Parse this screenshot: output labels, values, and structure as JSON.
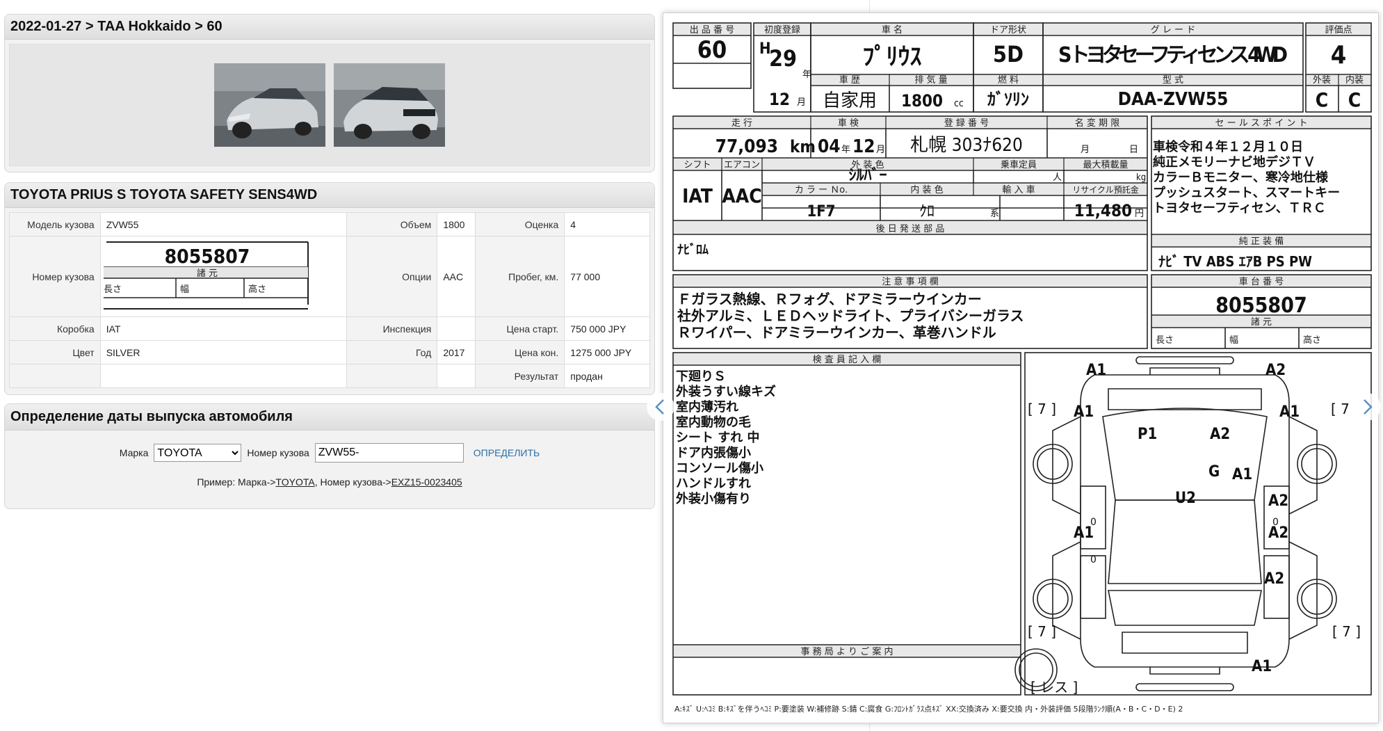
{
  "breadcrumb": "2022-01-27 > TAA Hokkaido > 60",
  "car_title": "TOYOTA PRIUS S TOYOTA SAFETY SENS4WD",
  "photos": [
    "front-left-view",
    "rear-right-view"
  ],
  "specs": {
    "body_model_label": "Модель кузова",
    "body_model": "ZVW55",
    "volume_label": "Объем",
    "volume": "1800",
    "grade_label": "Оценка",
    "grade": "4",
    "body_number_label": "Номер кузова",
    "options_label": "Опции",
    "options": "AAC",
    "mileage_label": "Пробег, км.",
    "mileage": "77 000",
    "gearbox_label": "Коробка",
    "gearbox": "IAT",
    "inspection_label": "Инспекция",
    "inspection": "",
    "start_price_label": "Цена старт.",
    "start_price": "750 000 JPY",
    "color_label": "Цвет",
    "color": "SILVER",
    "year_label": "Год",
    "year": "2017",
    "end_price_label": "Цена кон.",
    "end_price": "1275 000 JPY",
    "result_label": "Результат",
    "result": "продан"
  },
  "mini_sheet": {
    "number": "8055807",
    "specs": "諸 元",
    "length": "長さ",
    "width": "幅",
    "height": "高さ"
  },
  "date_tool": {
    "title": "Определение даты выпуска автомобиля",
    "make_label": "Марка",
    "make_value": "TOYOTA",
    "body_label": "Номер кузова",
    "body_value": "ZVW55-",
    "button": "ОПРЕДЕЛИТЬ",
    "example_prefix": "Пример: Марка->",
    "example_make": "TOYOTA",
    "example_mid": ", Номер кузова->",
    "example_body": "EXZ15-0023405"
  },
  "sheet": {
    "h_lot": "出 品 番 号",
    "lot": "60",
    "h_first_reg": "初度登録",
    "era": "H",
    "year_num": "29",
    "year_unit": "年",
    "month_num": "12",
    "month_unit": "月",
    "h_name": "車 名",
    "name": "ﾌﾟﾘｳｽ",
    "h_door": "ドア形状",
    "door": "5D",
    "h_grade": "グ レ ー ド",
    "grade": "S トヨタセーフティセンス 4WD",
    "h_score": "評価点",
    "score": "4",
    "h_history": "車 歴",
    "history": "自家用",
    "h_disp": "排 気 量",
    "disp": "1800",
    "disp_unit": "cc",
    "h_fuel": "燃 料",
    "fuel": "ｶﾞｿﾘﾝ",
    "h_model": "型 式",
    "model": "DAA-ZVW55",
    "h_ext": "外装",
    "ext": "C",
    "h_int": "内装",
    "int": "C",
    "h_mileage": "走 行",
    "mileage": "77,093",
    "mileage_unit": "km",
    "h_inspect": "車 検",
    "insp_y": "04",
    "insp_yu": "年",
    "insp_m": "12",
    "insp_mu": "月",
    "h_reg_no": "登 録 番 号",
    "reg_no": "札幌 303ﾅ620",
    "h_rename": "名 変 期 限",
    "rename_m": "月",
    "rename_d": "日",
    "h_sales": "セ ー ル ス ポ イ ン ト",
    "sales": [
      "車検令和４年１２月１０日",
      "純正メモリーナビ地デジＴＶ",
      "カラーＢモニター、寒冷地仕様",
      "プッシュスタート、スマートキー",
      "トヨタセーフティセン、ＴＲＣ"
    ],
    "h_shift": "シフト",
    "shift": "IAT",
    "h_ac": "エアコン",
    "ac": "AAC",
    "h_color": "外 装 色",
    "color": "ｼﾙﾊﾞｰ",
    "h_seats": "乗車定員",
    "seats_unit": "人",
    "h_load": "最大積載量",
    "load_unit": "kg",
    "h_color_no": "カ ラ ー Ｎo.",
    "color_no": "1F7",
    "h_interior": "内 装 色",
    "interior": "ｸﾛ",
    "interior_unit": "系",
    "h_import": "輸 入 車",
    "h_recycle": "リサイクル預託金",
    "recycle": "11,480",
    "recycle_unit": "円",
    "h_later": "後 日 発 送 部 品",
    "later": "ﾅﾋﾞﾛﾑ",
    "h_equip": "純 正 装 備",
    "equip": "ﾅﾋﾞ TV ABS ｴｱB PS PW",
    "h_notes": "注 意 事 項 欄",
    "notes": [
      "Ｆガラス熱線、Ｒフォグ、ドアミラーウインカー",
      "社外アルミ、ＬＥＤヘッドライト、プライバシーガラス",
      "Ｒワイパー、ドアミラーウインカー、革巻ハンドル"
    ],
    "h_chassis": "車 台 番 号",
    "chassis": "8055807",
    "h_spec": "諸 元",
    "len": "長さ",
    "wid": "幅",
    "hei": "高さ",
    "h_inspector": "検 査 員 記 入 欄",
    "inspector": [
      "下廻りＳ",
      "外装うすい線キズ",
      "室内薄汚れ",
      "室内動物の毛",
      "シート すれ 中",
      "ドア内張傷小",
      "コンソール傷小",
      "ハンドルすれ",
      "外装小傷有り"
    ],
    "h_office": "事 務 局 よ り ご 案 内",
    "legend": "A:ｷｽﾞ U:ﾍｺﾐ B:ｷｽﾞを伴うﾍｺﾐ P:要塗装 W:補修跡 S:錆 C:腐食 G:ﾌﾛﾝﾄｶﾞﾗｽ点ｷｽﾞ XX:交換済み X:要交換 内・外装評価 5段階ﾗﾝｸ順(A・B・C・D・E) 2",
    "marks": {
      "a1_fl": "A1",
      "a2_fr": "A2",
      "a1_l": "A1",
      "a1_r": "A1",
      "p1": "P1",
      "a2_c": "A2",
      "g": "G",
      "a1_g": "A1",
      "u2": "U2",
      "a2_r": "A2",
      "a1_l2": "A1",
      "a2_r2": "A2",
      "a2_r3": "A2",
      "a1_rear": "A1"
    },
    "tires": {
      "fl": "[ 7 ]",
      "fr": "[ 7",
      "rl": "[ 7 ]",
      "rr": "[ 7 ]",
      "spare": "[ レス ]"
    },
    "zeros": "0"
  }
}
